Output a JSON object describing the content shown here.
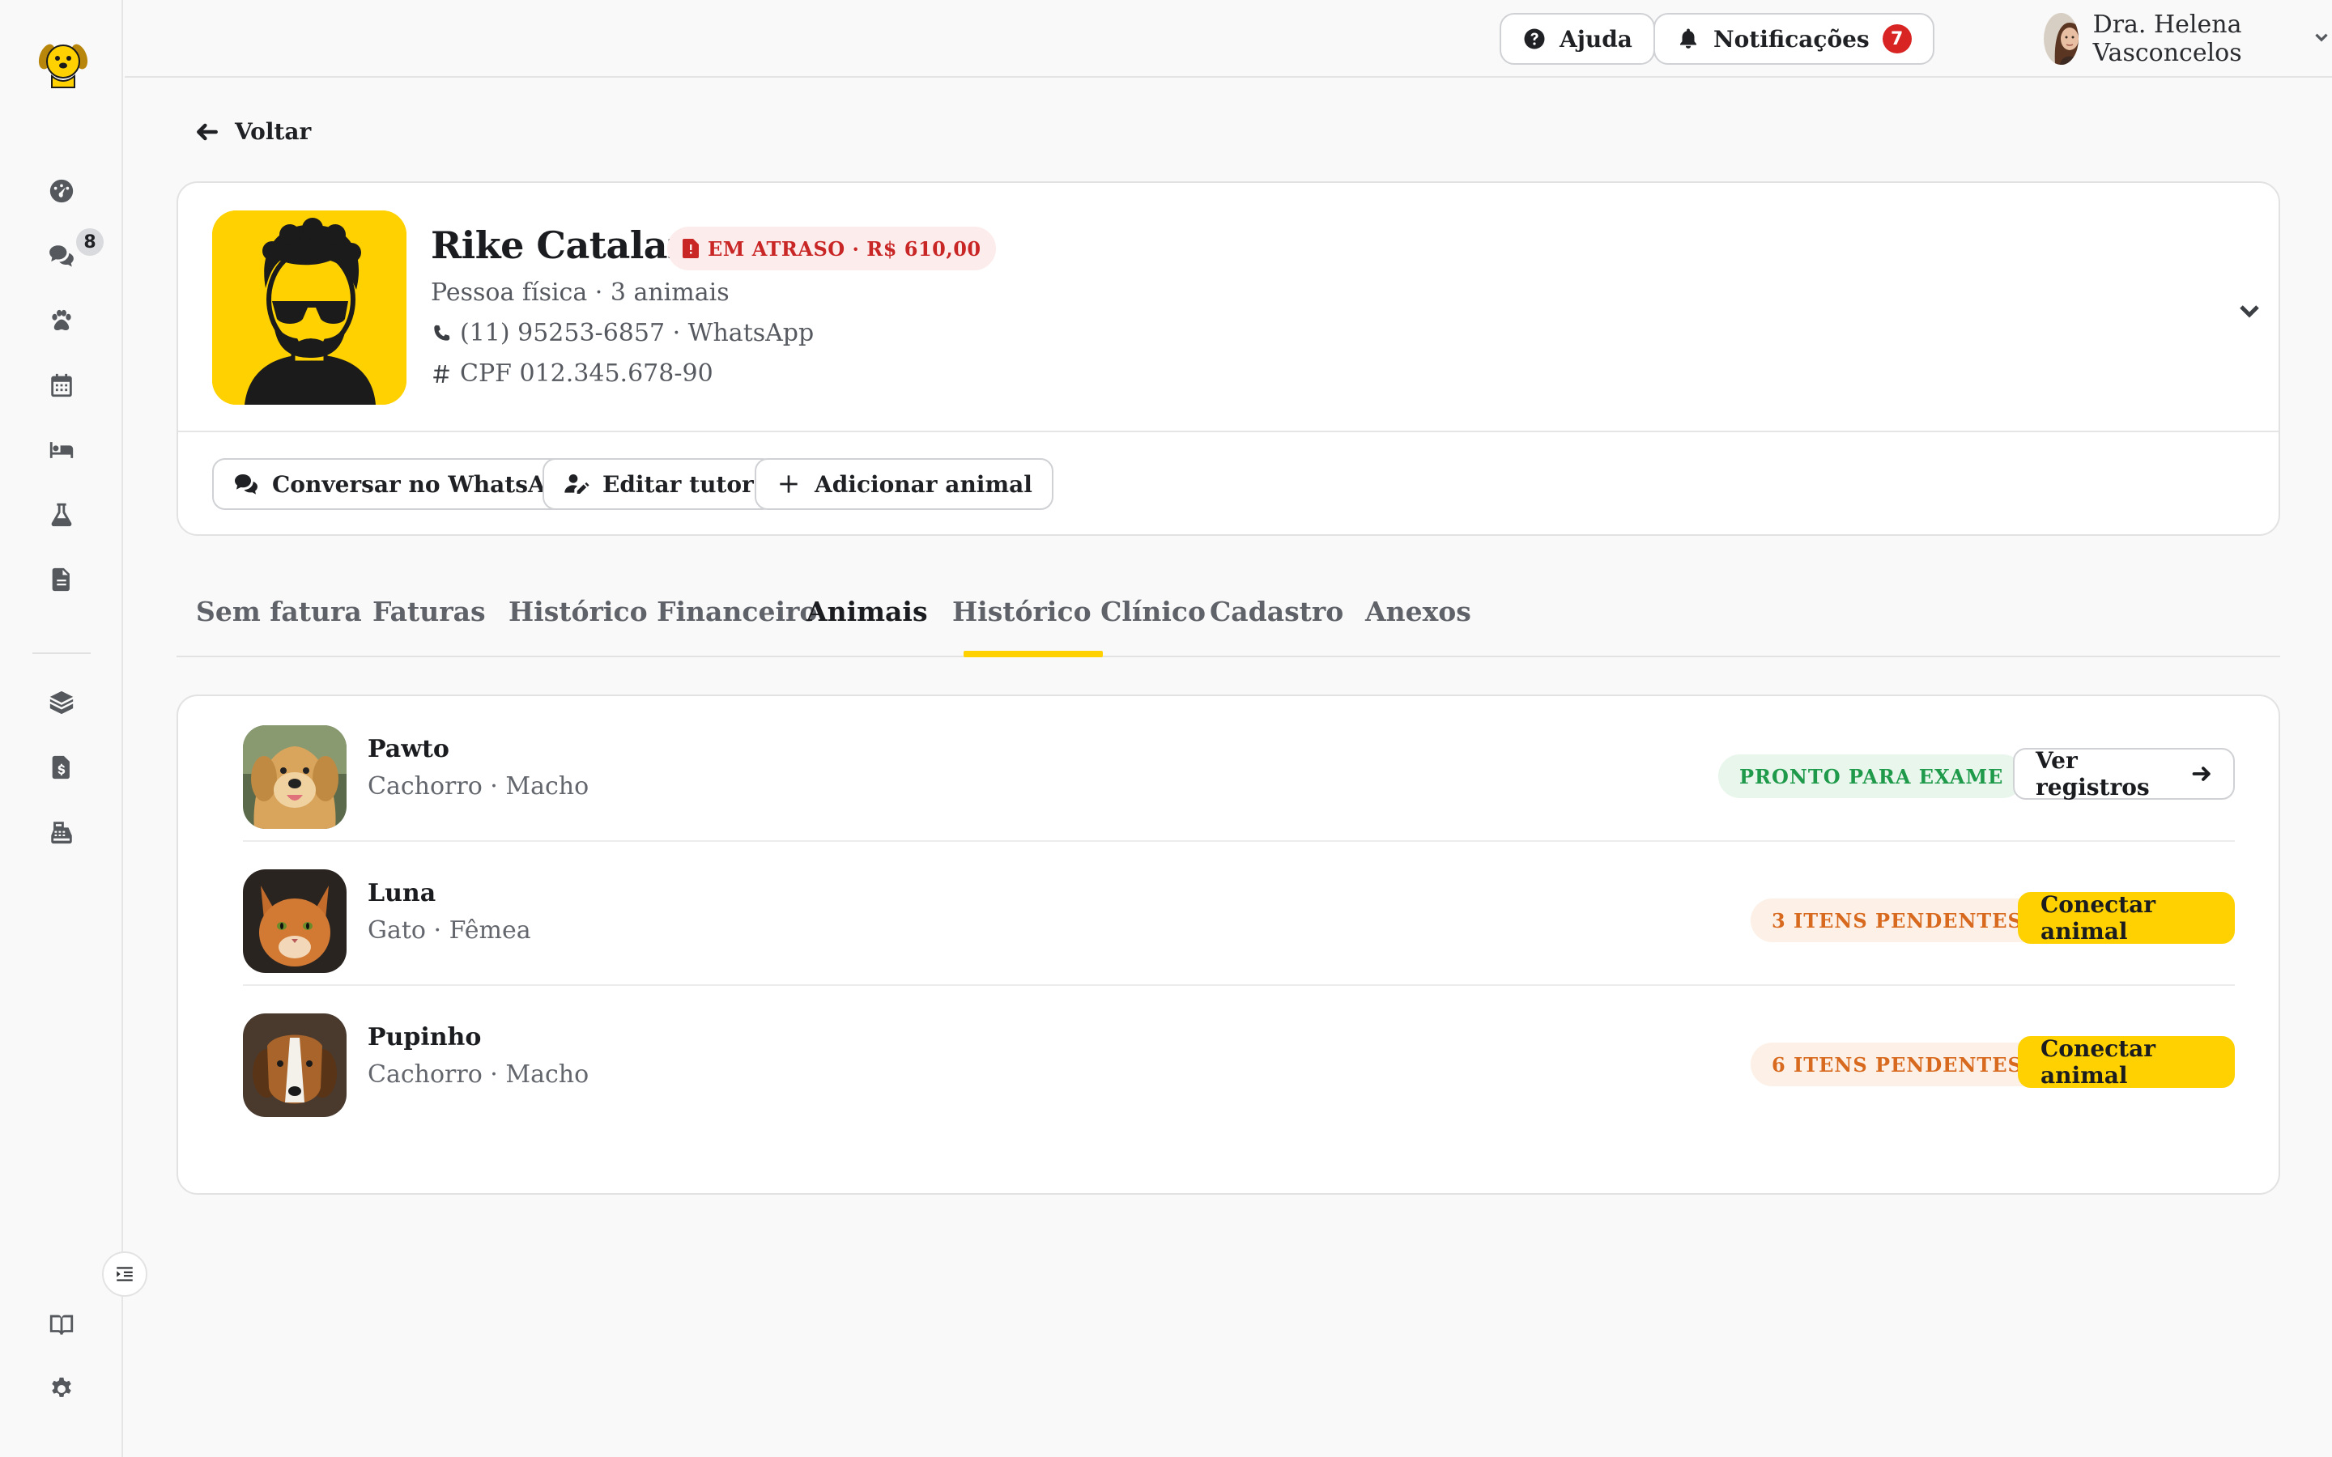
{
  "header": {
    "help_label": "Ajuda",
    "notifications_label": "Notificações",
    "notifications_count": "7",
    "user_name": "Dra. Helena Vasconcelos"
  },
  "sidebar": {
    "items": [
      {
        "icon": "dashboard-icon",
        "label": ""
      },
      {
        "icon": "chat-icon",
        "badge": "8"
      },
      {
        "icon": "paw-icon"
      },
      {
        "icon": "calendar-icon"
      },
      {
        "icon": "bed-icon"
      },
      {
        "icon": "flask-icon"
      },
      {
        "icon": "document-icon"
      },
      {
        "icon": "box-icon"
      },
      {
        "icon": "invoice-icon"
      },
      {
        "icon": "cash-register-icon"
      },
      {
        "icon": "book-icon"
      },
      {
        "icon": "gear-icon"
      }
    ]
  },
  "back_label": "Voltar",
  "tutor": {
    "name": "Rike Catalani",
    "badge": "EM ATRASO · R$ 610,00",
    "type_line": "Pessoa física · 3 animais",
    "phone_line": "(11) 95253-6857 · WhatsApp",
    "cpf_line": "CPF 012.345.678-90",
    "actions": {
      "whatsapp": "Conversar no WhatsApp",
      "edit": "Editar tutor",
      "add_animal": "Adicionar animal"
    }
  },
  "tabs": [
    {
      "label": "Sem fatura"
    },
    {
      "label": "Faturas"
    },
    {
      "label": "Histórico Financeiro"
    },
    {
      "label": "Animais",
      "active": true
    },
    {
      "label": "Histórico Clínico"
    },
    {
      "label": "Cadastro"
    },
    {
      "label": "Anexos"
    }
  ],
  "animals": [
    {
      "name": "Pawto",
      "meta": "Cachorro · Macho",
      "status": "PRONTO PARA EXAME",
      "status_kind": "ready",
      "action": "Ver registros"
    },
    {
      "name": "Luna",
      "meta": "Gato · Fêmea",
      "status": "3 ITENS PENDENTES",
      "status_kind": "pending",
      "action": "Conectar animal"
    },
    {
      "name": "Pupinho",
      "meta": "Cachorro · Macho",
      "status": "6 ITENS PENDENTES",
      "status_kind": "pending",
      "action": "Conectar animal"
    }
  ],
  "colors": {
    "accent": "#ffd100",
    "danger": "#c92626",
    "success": "#1f9a4a",
    "warning": "#d86a1f"
  }
}
